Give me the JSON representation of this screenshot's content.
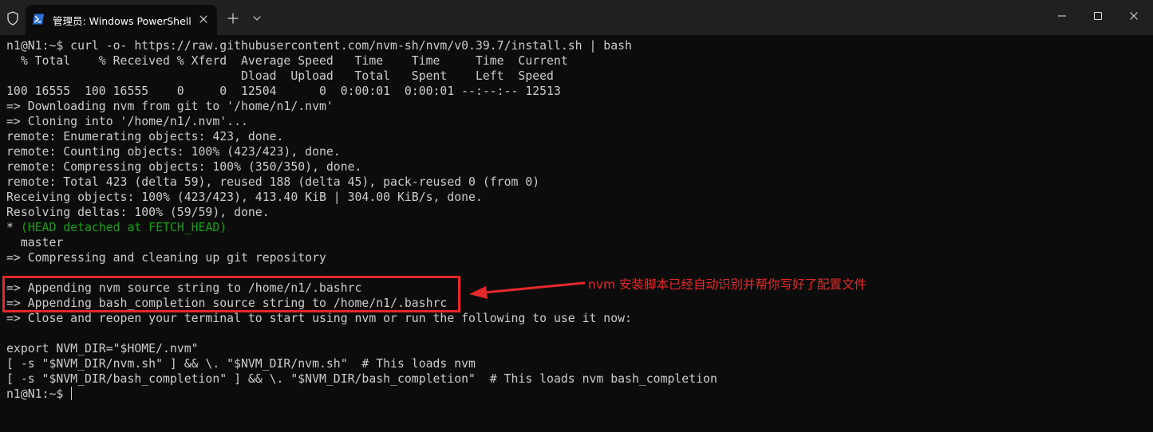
{
  "window": {
    "tab_title": "管理员: Windows PowerShell",
    "icons": {
      "shield": "shield-icon",
      "powershell": "powershell-icon",
      "close": "close-icon",
      "add": "plus-icon",
      "dropdown": "chevron-down-icon",
      "minimize": "minimize-icon",
      "maximize": "maximize-icon",
      "window_close": "close-window-icon"
    }
  },
  "colors": {
    "terminal_bg": "#0c0c0c",
    "terminal_text": "#cccccc",
    "git_head_green": "#13a10e",
    "annotation_red": "#e5292b",
    "titlebar_bg": "#202020"
  },
  "terminal": {
    "lines": [
      "n1@N1:~$ curl -o- https://raw.githubusercontent.com/nvm-sh/nvm/v0.39.7/install.sh | bash",
      "  % Total    % Received % Xferd  Average Speed   Time    Time     Time  Current",
      "                                 Dload  Upload   Total   Spent    Left  Speed",
      "100 16555  100 16555    0     0  12504      0  0:00:01  0:00:01 --:--:-- 12513",
      "=> Downloading nvm from git to '/home/n1/.nvm'",
      "=> Cloning into '/home/n1/.nvm'...",
      "remote: Enumerating objects: 423, done.",
      "remote: Counting objects: 100% (423/423), done.",
      "remote: Compressing objects: 100% (350/350), done.",
      "remote: Total 423 (delta 59), reused 188 (delta 45), pack-reused 0 (from 0)",
      "Receiving objects: 100% (423/423), 413.40 KiB | 304.00 KiB/s, done.",
      "Resolving deltas: 100% (59/59), done."
    ],
    "head_prefix": "* ",
    "head_text": "(HEAD detached at FETCH_HEAD)",
    "lines_after": [
      "  master",
      "=> Compressing and cleaning up git repository",
      "",
      "=> Appending nvm source string to /home/n1/.bashrc",
      "=> Appending bash_completion source string to /home/n1/.bashrc",
      "=> Close and reopen your terminal to start using nvm or run the following to use it now:",
      "",
      "export NVM_DIR=\"$HOME/.nvm\"",
      "[ -s \"$NVM_DIR/nvm.sh\" ] && \\. \"$NVM_DIR/nvm.sh\"  # This loads nvm",
      "[ -s \"$NVM_DIR/bash_completion\" ] && \\. \"$NVM_DIR/bash_completion\"  # This loads nvm bash_completion"
    ],
    "prompt": "n1@N1:~$ "
  },
  "annotation": {
    "text": "nvm 安装脚本已经自动识别并帮你写好了配置文件"
  }
}
